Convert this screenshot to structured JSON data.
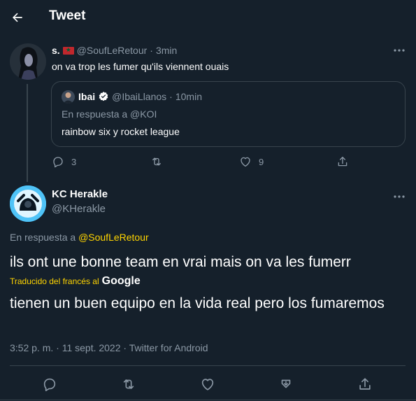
{
  "header": {
    "title": "Tweet",
    "back_icon": "arrow-left-icon"
  },
  "colors": {
    "background": "#15202b",
    "muted": "#8b98a5",
    "border": "#38444d",
    "accent_link": "#ffd400"
  },
  "parent_tweet": {
    "display_name": "s.",
    "handle": "@SoufLeRetour",
    "time": "3min",
    "separator": "·",
    "text": "on va trop les fumer qu'ils viennent ouais",
    "quoted_tweet": {
      "display_name": "Ibai",
      "handle": "@IbaiLlanos",
      "time": "10min",
      "replying_to": "En respuesta a @KOI",
      "text": "rainbow six y rocket league"
    },
    "actions": {
      "replies": "3",
      "likes": "9"
    }
  },
  "main_tweet": {
    "display_name": "KC Herakle",
    "handle": "@KHerakle",
    "replying_prefix": "En respuesta a ",
    "replying_handle": "@SoufLeRetour",
    "text": "ils ont une bonne team en vrai mais on va les fumerr",
    "translated_label": "Traducido del francés al",
    "translated_provider": "Google",
    "translation": "tienen un buen equipo en la vida real pero los fumaremos",
    "timestamp": "3:52 p. m. · 11 sept. 2022 · Twitter for Android"
  }
}
